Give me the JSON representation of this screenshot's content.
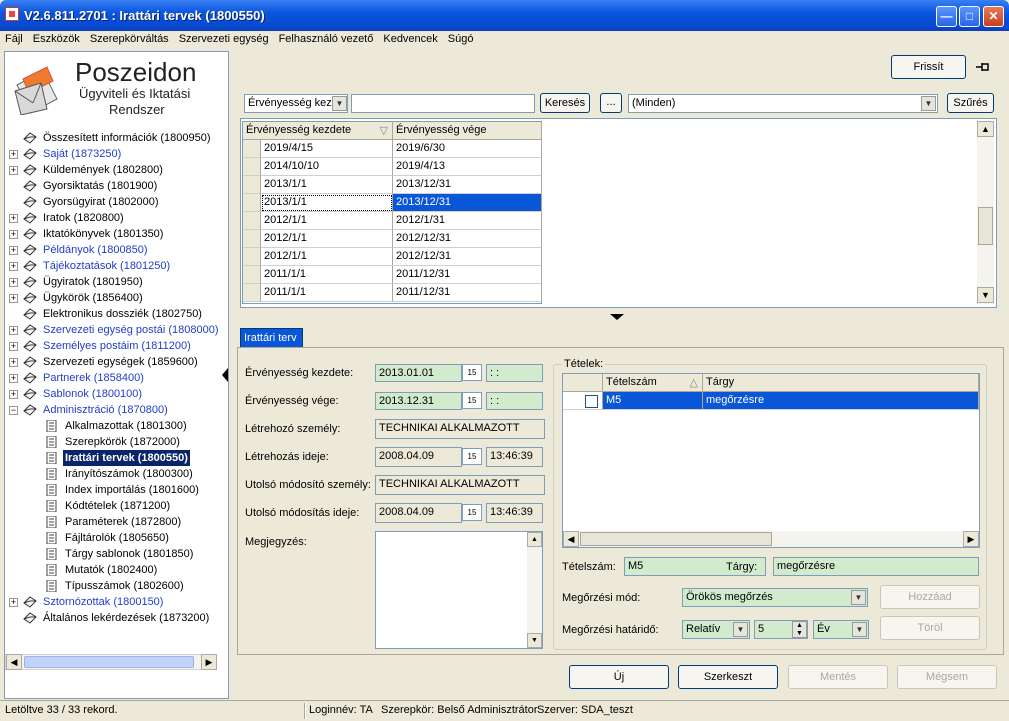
{
  "window": {
    "title": "V2.6.811.2701 : Irattári tervek (1800550)"
  },
  "menu": [
    "Fájl",
    "Eszközök",
    "Szerepkörváltás",
    "Szervezeti egység",
    "Felhasználó vezető",
    "Kedvencek",
    "Súgó"
  ],
  "logo": {
    "line1": "Poszeidon",
    "line2": "Ügyviteli és Iktatási",
    "line3": "Rendszer"
  },
  "tree": [
    {
      "label": "Összesített információk (1800950)",
      "level": 0,
      "exp": false,
      "blue": false
    },
    {
      "label": "Saját (1873250)",
      "level": 0,
      "exp": true,
      "blue": true
    },
    {
      "label": "Küldemények (1802800)",
      "level": 0,
      "exp": true,
      "blue": false
    },
    {
      "label": "Gyorsiktatás (1801900)",
      "level": 0,
      "exp": false,
      "blue": false
    },
    {
      "label": "Gyorsügyirat (1802000)",
      "level": 0,
      "exp": false,
      "blue": false
    },
    {
      "label": "Iratok (1820800)",
      "level": 0,
      "exp": true,
      "blue": false
    },
    {
      "label": "Iktatókönyvek (1801350)",
      "level": 0,
      "exp": true,
      "blue": false
    },
    {
      "label": "Példányok (1800850)",
      "level": 0,
      "exp": true,
      "blue": true
    },
    {
      "label": "Tájékoztatások (1801250)",
      "level": 0,
      "exp": true,
      "blue": true
    },
    {
      "label": "Ügyiratok (1801950)",
      "level": 0,
      "exp": true,
      "blue": false
    },
    {
      "label": "Ügykörök (1856400)",
      "level": 0,
      "exp": true,
      "blue": false
    },
    {
      "label": "Elektronikus dossziék (1802750)",
      "level": 0,
      "exp": false,
      "blue": false
    },
    {
      "label": "Szervezeti egység postái (1808000)",
      "level": 0,
      "exp": true,
      "blue": true
    },
    {
      "label": "Személyes postáim (1811200)",
      "level": 0,
      "exp": true,
      "blue": true
    },
    {
      "label": "Szervezeti egységek (1859600)",
      "level": 0,
      "exp": true,
      "blue": false
    },
    {
      "label": "Partnerek (1858400)",
      "level": 0,
      "exp": true,
      "blue": true
    },
    {
      "label": "Sablonok (1800100)",
      "level": 0,
      "exp": true,
      "blue": true
    },
    {
      "label": "Adminisztráció (1870800)",
      "level": 0,
      "exp": "open",
      "blue": true
    },
    {
      "label": "Alkalmazottak (1801300)",
      "level": 1,
      "exp": false,
      "blue": false
    },
    {
      "label": "Szerepkörök (1872000)",
      "level": 1,
      "exp": false,
      "blue": false
    },
    {
      "label": "Irattári tervek (1800550)",
      "level": 1,
      "exp": false,
      "blue": false,
      "selected": true
    },
    {
      "label": "Irányítószámok (1800300)",
      "level": 1,
      "exp": false,
      "blue": false
    },
    {
      "label": "Index importálás (1801600)",
      "level": 1,
      "exp": false,
      "blue": false
    },
    {
      "label": "Kódtételek (1871200)",
      "level": 1,
      "exp": false,
      "blue": false
    },
    {
      "label": "Paraméterek (1872800)",
      "level": 1,
      "exp": false,
      "blue": false
    },
    {
      "label": "Fájltárolók (1805650)",
      "level": 1,
      "exp": false,
      "blue": false
    },
    {
      "label": "Tárgy sablonok (1801850)",
      "level": 1,
      "exp": false,
      "blue": false
    },
    {
      "label": "Mutatók (1802400)",
      "level": 1,
      "exp": false,
      "blue": false
    },
    {
      "label": "Típusszámok (1802600)",
      "level": 1,
      "exp": false,
      "blue": false
    },
    {
      "label": "Sztornózottak (1800150)",
      "level": 0,
      "exp": true,
      "blue": true
    },
    {
      "label": "Általános lekérdezések (1873200)",
      "level": 0,
      "exp": false,
      "blue": false
    }
  ],
  "toolbar": {
    "refresh": "Frissít",
    "filter_field": "Érvényesség kez",
    "search_value": "",
    "search_button": "Keresés",
    "ellipsis": "...",
    "filter_select": "(Minden)",
    "filter_button": "Szűrés"
  },
  "grid": {
    "columns": [
      "Érvényesség kezdete",
      "Érvényesség vége"
    ],
    "rows": [
      [
        "2019/4/15",
        "2019/6/30"
      ],
      [
        "2014/10/10",
        "2019/4/13"
      ],
      [
        "2013/1/1",
        "2013/12/31"
      ],
      [
        "2013/1/1",
        "2013/12/31"
      ],
      [
        "2012/1/1",
        "2012/1/31"
      ],
      [
        "2012/1/1",
        "2012/12/31"
      ],
      [
        "2012/1/1",
        "2012/12/31"
      ],
      [
        "2011/1/1",
        "2011/12/31"
      ],
      [
        "2011/1/1",
        "2011/12/31"
      ]
    ],
    "selected_row": 3
  },
  "tab": {
    "label": "Irattári terv"
  },
  "form": {
    "start_label": "Érvényesség kezdete:",
    "start_value": "2013.01.01",
    "start_time": " :  :",
    "end_label": "Érvényesség vége:",
    "end_value": "2013.12.31",
    "end_time": " :  :",
    "creator_label": "Létrehozó személy:",
    "creator_value": "TECHNIKAI ALKALMAZOTT",
    "created_label": "Létrehozás ideje:",
    "created_date": "2008.04.09",
    "created_time": "13:46:39",
    "modifier_label": "Utolsó módosító személy:",
    "modifier_value": "TECHNIKAI ALKALMAZOTT",
    "modified_label": "Utolsó módosítás ideje:",
    "modified_date": "2008.04.09",
    "modified_time": "13:46:39",
    "note_label": "Megjegyzés:",
    "cal_icon": "15"
  },
  "items": {
    "group_label": "Tételek:",
    "columns": [
      "Tételszám",
      "Tárgy"
    ],
    "rows": [
      [
        "M5",
        "megőrzésre"
      ]
    ],
    "itemno_label": "Tételszám:",
    "itemno_value": "M5",
    "subject_label": "Tárgy:",
    "subject_value": "megőrzésre",
    "retention_label": "Megőrzési mód:",
    "retention_value": "Örökös megőrzés",
    "deadline_label": "Megőrzési határidő:",
    "deadline_type": "Relatív",
    "deadline_num": "5",
    "deadline_unit": "Év",
    "add_button": "Hozzáad",
    "delete_button": "Töröl"
  },
  "actions": {
    "new": "Új",
    "edit": "Szerkeszt",
    "save": "Mentés",
    "cancel": "Mégsem"
  },
  "status": {
    "records": "Letöltve 33 / 33 rekord.",
    "login": "Loginnév: TA",
    "role": "Szerepkör: Belső Adminisztrátor",
    "server": "Szerver: SDA_teszt"
  },
  "colors": {
    "titlebar": "#0a56e0",
    "selection": "#0a56d8",
    "green_field": "#d2ebcd",
    "tree_blue": "#1e3ec8"
  }
}
